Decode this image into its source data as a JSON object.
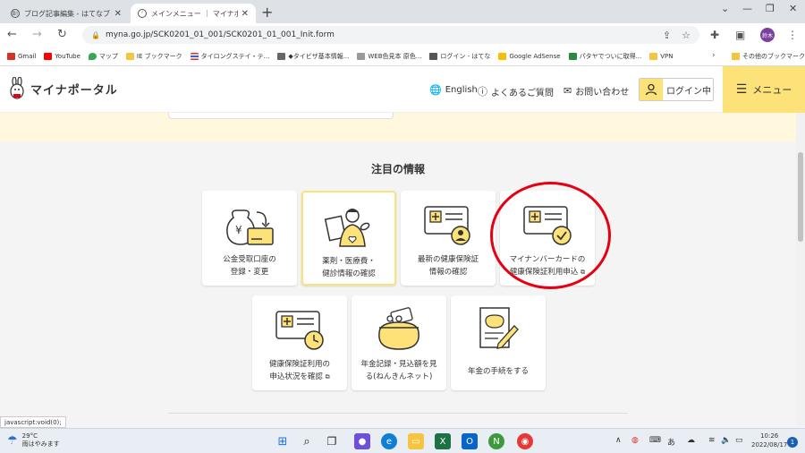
{
  "browser": {
    "tabs": [
      {
        "title": "ブログ記事編集 - はてなブログ",
        "active": false
      },
      {
        "title": "メインメニュー ｜ マイナポータル",
        "active": true
      }
    ],
    "new_tab": "+",
    "window_controls": [
      "⌄",
      "—",
      "❐",
      "✕"
    ],
    "url": "myna.go.jp/SCK0201_01_001/SCK0201_01_001_Init.form",
    "profile_initials": "鈴木"
  },
  "bookmarks": {
    "items": [
      {
        "label": "Gmail",
        "color": "#d93025"
      },
      {
        "label": "YouTube",
        "color": "#ff0000"
      },
      {
        "label": "マップ",
        "color": "#34a853"
      },
      {
        "label": "IE ブックマーク",
        "color": "#f5c542"
      },
      {
        "label": "タイロングステイ・テ...",
        "color": "#3b5bdb"
      },
      {
        "label": "◆タイビザ基本情報...",
        "color": "#666666"
      },
      {
        "label": "WEB色見本 原色...",
        "color": "#999999"
      },
      {
        "label": "ログイン - はてな",
        "color": "#555555"
      },
      {
        "label": "Google AdSense",
        "color": "#fbbc04"
      },
      {
        "label": "パタヤでついに取得...",
        "color": "#2b8a3e"
      },
      {
        "label": "VPN",
        "color": "#f5c542"
      }
    ],
    "more": "›",
    "other": "その他のブックマーク"
  },
  "header": {
    "logo_text": "マイナポータル",
    "english": "English",
    "faq": "よくあるご質問",
    "contact": "お問い合わせ",
    "login": "ログイン中",
    "menu": "メニュー"
  },
  "section": {
    "title": "注目の情報"
  },
  "cards": [
    {
      "label_line1": "公金受取口座の",
      "label_line2": "登録・変更"
    },
    {
      "label_line1": "薬剤・医療費・",
      "label_line2": "健診情報の確認"
    },
    {
      "label_line1": "最新の健康保険証",
      "label_line2": "情報の確認"
    },
    {
      "label_line1": "マイナンバーカードの",
      "label_line2": "健康保険証利用申込"
    },
    {
      "label_line1": "健康保険証利用の",
      "label_line2": "申込状況を確認"
    },
    {
      "label_line1": "年金記録・見込額を見",
      "label_line2": "る(ねんきんネット)"
    },
    {
      "label_line1": "年金の手続をする",
      "label_line2": ""
    }
  ],
  "status_bar": "javascript:void(0);",
  "taskbar": {
    "temperature": "29°C",
    "weather": "雨はやみます",
    "time": "10:26",
    "date": "2022/08/17",
    "ime": "あ",
    "notification_count": "1"
  },
  "colors": {
    "accent_yellow": "#fde27a",
    "band_yellow": "#fff8df",
    "annotation_red": "#e60012"
  }
}
